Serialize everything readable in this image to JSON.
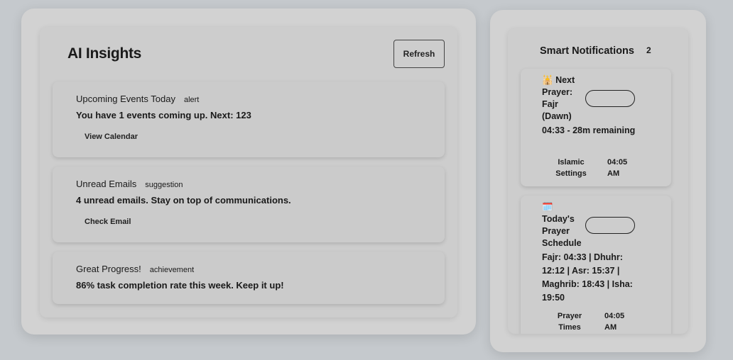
{
  "insights": {
    "title": "AI Insights",
    "refresh_label": "Refresh",
    "cards": [
      {
        "title": "Upcoming Events Today",
        "tag": "alert",
        "message": "You have 1 events coming up. Next: 123",
        "action": "View Calendar"
      },
      {
        "title": "Unread Emails",
        "tag": "suggestion",
        "message": "4 unread emails. Stay on top of communications.",
        "action": "Check Email"
      },
      {
        "title": "Great Progress!",
        "tag": "achievement",
        "message": "86% task completion rate this week. Keep it up!"
      }
    ]
  },
  "notifications": {
    "title": "Smart Notifications",
    "count": "2",
    "items": [
      {
        "icon": "🕌",
        "title": "Next Prayer: Fajr (Dawn)",
        "message": "04:33 - 28m remaining",
        "source": "Islamic Settings",
        "time": "04:05 AM"
      },
      {
        "icon": "🗓️",
        "title": "Today's Prayer Schedule",
        "message": "Fajr: 04:33 | Dhuhr: 12:12 | Asr: 15:37 | Maghrib: 18:43 | Isha: 19:50",
        "source": "Prayer Times",
        "time": "04:05 AM"
      }
    ]
  }
}
